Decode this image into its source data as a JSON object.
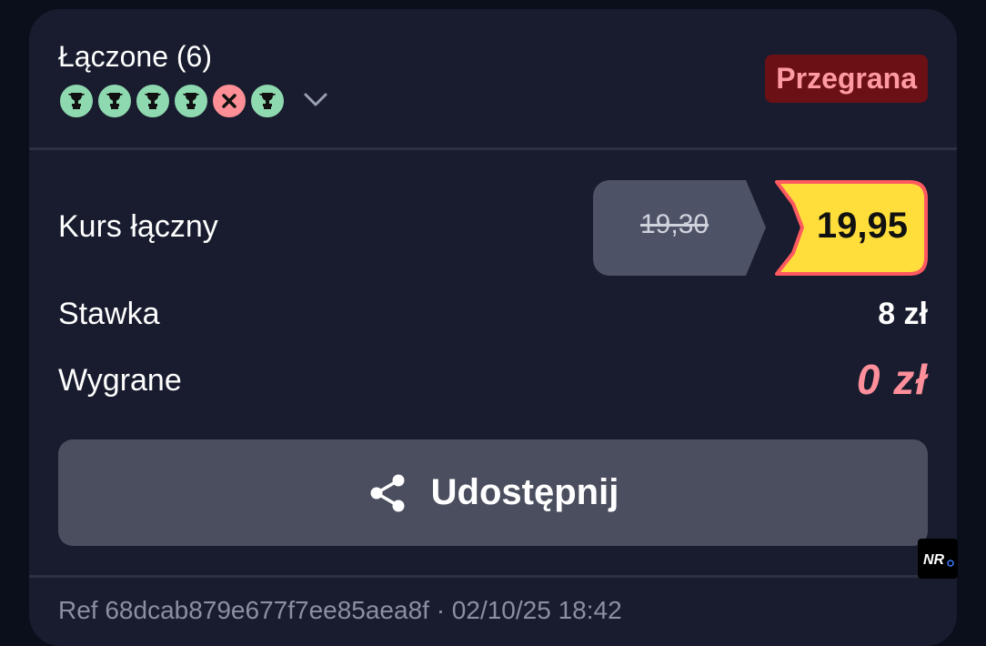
{
  "bet": {
    "title": "Łączone (6)",
    "status": "Przegrana",
    "legs": [
      {
        "result": "won",
        "icon": "trophy-icon"
      },
      {
        "result": "won",
        "icon": "trophy-icon"
      },
      {
        "result": "won",
        "icon": "trophy-icon"
      },
      {
        "result": "won",
        "icon": "trophy-icon"
      },
      {
        "result": "lost",
        "icon": "x-icon"
      },
      {
        "result": "won",
        "icon": "trophy-icon"
      }
    ],
    "expand_icon": "chevron-down-icon"
  },
  "details": {
    "odds_label": "Kurs łączny",
    "odds_old": "19,30",
    "odds_new": "19,95",
    "stake_label": "Stawka",
    "stake_value": "8 zł",
    "win_label": "Wygrane",
    "win_value": "0 zł"
  },
  "share": {
    "label": "Udostępnij",
    "icon": "share-icon"
  },
  "footer": {
    "ref": "Ref 68dcab879e677f7ee85aea8f · 02/10/25 18:42"
  },
  "watermark": {
    "text": "NR",
    "icon": "brand-logo-icon"
  },
  "colors": {
    "background": "#0b0f1c",
    "card": "#181c2e",
    "won": "#8fd9b0",
    "lost": "#ff8f96",
    "status_bg": "#6b1015",
    "status_text": "#ff9aa2",
    "odds_boost": "#ffde3c",
    "odds_boost_border": "#ff5a5f",
    "share_button": "#4a4e5e"
  }
}
